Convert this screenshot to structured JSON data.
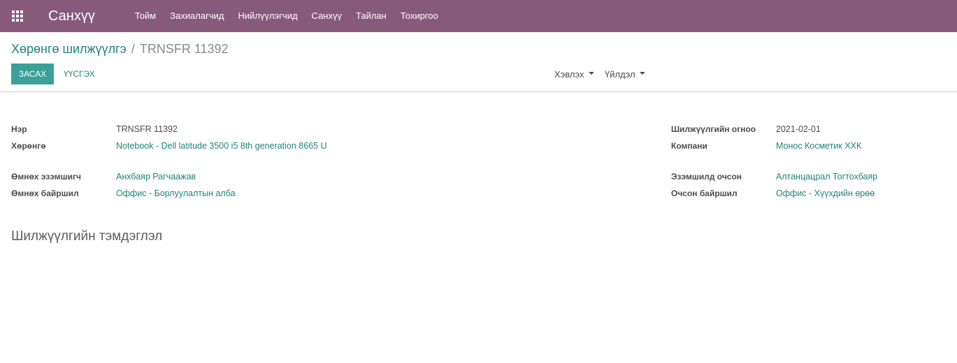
{
  "navbar": {
    "app_title": "Санхүү",
    "menu": [
      "Тойм",
      "Захиалагчид",
      "Нийлүүлэгчид",
      "Санхүү",
      "Тайлан",
      "Тохиргоо"
    ]
  },
  "breadcrumb": {
    "parent": "Хөрөнгө шилжүүлгэ",
    "separator": "/",
    "current": "TRNSFR 11392"
  },
  "buttons": {
    "edit": "ЗАСАХ",
    "create": "ҮҮСГЭХ",
    "print": "Хэвлэх",
    "action": "Үйлдэл"
  },
  "form": {
    "left": [
      {
        "label": "Нэр",
        "value": "TRNSFR 11392",
        "link": false
      },
      {
        "label": "Хөрөнгө",
        "value": "Notebook - Dell latitude 3500 i5 8th generation 8665 U",
        "link": true
      },
      {
        "label": "Өмнөх эзэмшигч",
        "value": "Анхбаяр Рагчаажав",
        "link": true
      },
      {
        "label": "Өмнөх байршил",
        "value": "Оффис - Борлуулалтын алба",
        "link": true
      }
    ],
    "right": [
      {
        "label": "Шилжүүлгийн огноо",
        "value": "2021-02-01",
        "link": false
      },
      {
        "label": "Компани",
        "value": "Монос Косметик ХХК",
        "link": true
      },
      {
        "label": "Эзэмшилд очсон",
        "value": "Алтанцацрал Тогтохбаяр",
        "link": true
      },
      {
        "label": "Очсон байршил",
        "value": "Оффис - Хүүхдийн өрөө",
        "link": true
      }
    ],
    "notes_title": "Шилжүүлгийн тэмдэглэл"
  }
}
